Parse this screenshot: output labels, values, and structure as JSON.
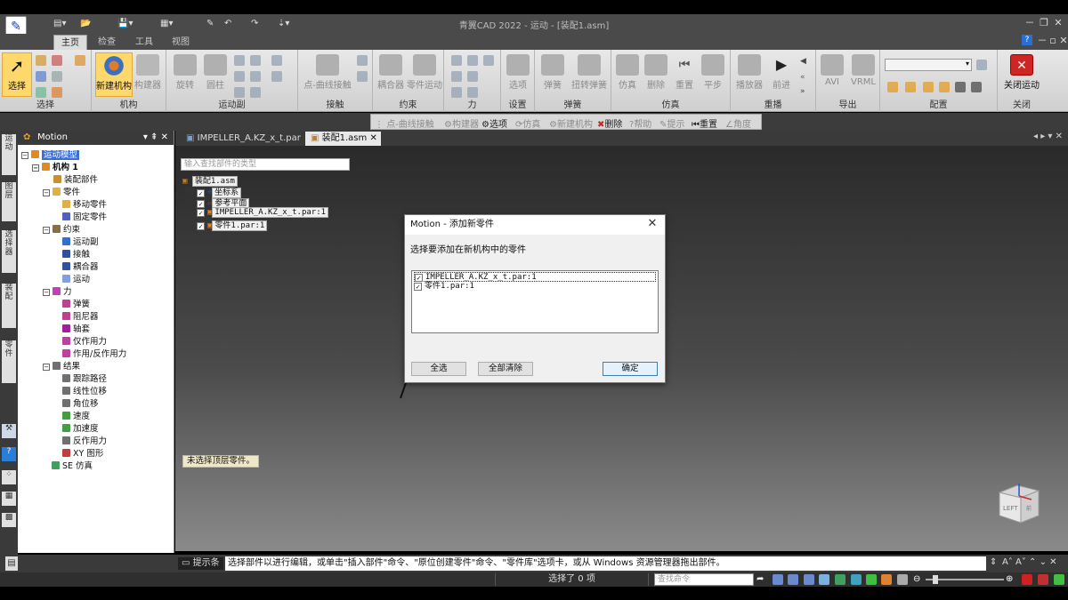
{
  "window": {
    "title": "青翼CAD 2022 - 运动 - [装配1.asm]",
    "controls": [
      "－",
      "❐",
      "✕"
    ]
  },
  "ribbon_tabs": [
    "主页",
    "检查",
    "工具",
    "视图"
  ],
  "ribbon": {
    "select": {
      "button": "选择",
      "group": "选择"
    },
    "mechanism": {
      "new": "新建机构",
      "builder": "构建器",
      "group": "机构"
    },
    "joints": {
      "revolute": "旋转",
      "cylindrical": "圆柱",
      "group": "运动副"
    },
    "contact": {
      "pt_curve": "点-曲线接触",
      "group": "接触"
    },
    "constraints": {
      "coupler": "耦合器",
      "part_motion": "零件运动",
      "group": "约束"
    },
    "force": {
      "group": "力"
    },
    "settings": {
      "options": "选项",
      "group": "设置"
    },
    "spring": {
      "spring": "弹簧",
      "torsion": "扭转弹簧",
      "group": "弹簧"
    },
    "simulation": {
      "simulate": "仿真",
      "delete": "删除",
      "reset": "重置",
      "step": "平步",
      "group": "仿真"
    },
    "replay": {
      "player": "播放器",
      "step_forward": "前进",
      "group": "重播"
    },
    "export": {
      "avi": "AVI",
      "vrml": "VRML",
      "group": "导出"
    },
    "config": {
      "group": "配置"
    },
    "close": {
      "close_motion": "关闭运动",
      "group": "关闭"
    }
  },
  "toolbar2": {
    "pt_curve": "点-曲线接触",
    "builder": "构建器",
    "options": "选项",
    "simulate": "仿真",
    "new_mechanism": "新建机构",
    "delete": "删除",
    "help": "帮助",
    "prompt": "提示",
    "reset": "重置",
    "angle": "角度"
  },
  "left_rail": [
    "运动",
    "图层",
    "选择器",
    "装配",
    "零件"
  ],
  "panel": {
    "title": "Motion",
    "tree": {
      "root": "运动模型",
      "mechanism": "机构 1",
      "assembly_parts": "装配部件",
      "parts": "零件",
      "moving_parts": "移动零件",
      "fixed_parts": "固定零件",
      "constraints": "约束",
      "joints": "运动副",
      "contact": "接触",
      "coupler": "耦合器",
      "motion": "运动",
      "force": "力",
      "spring": "弹簧",
      "damper": "阻尼器",
      "bushing": "轴套",
      "action_force": "仅作用力",
      "action_reaction": "作用/反作用力",
      "results": "结果",
      "trace": "跟踪路径",
      "linear_disp": "线性位移",
      "angular_disp": "角位移",
      "velocity": "速度",
      "acceleration": "加速度",
      "reaction": "反作用力",
      "xy_graph": "XY 图形",
      "se_sim": "SE 仿真"
    }
  },
  "doc_tabs": [
    "IMPELLER_A.KZ_x_t.par",
    "装配1.asm"
  ],
  "canvas": {
    "find_placeholder": "输入查找部件的类型",
    "tree": {
      "assembly": "装配1.asm",
      "coord": "坐标系",
      "ref_planes": "参考平面",
      "part1": "IMPELLER_A.KZ_x_t.par:1",
      "part2": "零件1.par:1"
    },
    "status": "未选择顶层零件。",
    "viewcube": {
      "left": "LEFT",
      "front": "前"
    }
  },
  "dialog": {
    "title": "Motion - 添加新零件",
    "prompt": "选择要添加在新机构中的零件",
    "items": [
      "IMPELLER_A.KZ_x_t.par:1",
      "零件1.par:1"
    ],
    "select_all": "全选",
    "clear_all": "全部清除",
    "ok": "确定"
  },
  "promptbar": {
    "label": "提示条",
    "text": "选择部件以进行编辑，或单击\"插入部件\"命令、\"原位创建零件\"命令、\"零件库\"选项卡，或从 Windows 资源管理器拖出部件。"
  },
  "statusbar": {
    "selected": "选择了 0 项",
    "cmd_placeholder": "查找命令"
  }
}
